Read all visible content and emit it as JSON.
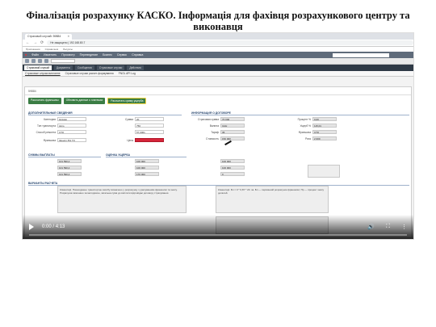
{
  "slide": {
    "title": "Фіналізація розрахунку КАСКО. Інформація для фахівця розрахункового центру та виконавця"
  },
  "browser": {
    "tab_label": "Страховой случай: 59884",
    "url": "Не защищено | 192.168.80.7",
    "bookmarks": [
      "Приложения",
      "Справочник",
      "Ресурсы"
    ]
  },
  "app": {
    "menu": [
      "Файл",
      "Изменить",
      "Просмотр",
      "Переведение",
      "Бизнес",
      "Сервис",
      "Справка"
    ],
    "window_tabs": [
      "Страховой случай",
      "Документы",
      "Сообщения",
      "Страховые случаи",
      "Действия"
    ],
    "sub_tabs": [
      "Страховые случаи виплатне",
      "Страховые случаи расчет-формування",
      "FNOL API Log"
    ],
    "panel_id": "59884",
    "actions": [
      "Рассчитать франшизы",
      "Обновить данные о платежах",
      "Рассчитать сумму ущерба"
    ],
    "sections": {
      "general": "Дополнительные сведения",
      "contract": "Информация о договоре",
      "payout": "Суммы выплаты",
      "damage": "Оценка ущерба",
      "calc": "Варианты расчета"
    },
    "fields": {
      "level": "Низкая",
      "level_label": "Категория",
      "vehicle_label": "Тип транспорта",
      "vehicle": "Авто",
      "sto_label": "Способ ремонта",
      "sto": "СТО",
      "amount_label": "Сумма",
      "amount": "1",
      "deductible_label": "Франшиза",
      "deductible_val": "Зачисл.5% ТЗ",
      "sum1": "20",
      "sum2": "750",
      "sum3": "57,0001",
      "price_label": "Цена",
      "ins_sum_label": "Страховая сумма",
      "ins_sum": "70 000",
      "currency_label": "Валюта",
      "currency": "UAH",
      "tariff_label": "Тариф",
      "tariff": "36",
      "ins_value_label": "Стоимость",
      "ins_value": "150 000",
      "pct_label": "Процент %",
      "pct": "0,00",
      "damage_label": "Ущерб %",
      "damage": "115,01",
      "ded_label": "Франшиза",
      "ded": "СТО",
      "ded_pct": "1",
      "ded_sum": "0",
      "risk_label": "Риск",
      "risk": "2 000",
      "payout1": "101 590,2",
      "payout2": "101 590,2",
      "payout3": "101 590,2",
      "est1": "100 000",
      "est2": "100 000",
      "est3": "170 000",
      "est_r1": "100 000",
      "est_r2": "100 000",
      "est_r3": "0",
      "notes_left": "Коментарі. Пошкоджене транспортне засобу визначено у розрахунку з урахуванням франшизи та зносу. Розрахунок виконано за методикою, загальна сума до виплати відповідає договору страхування.",
      "notes_right": "Коментарі. Бл = 0 * 0,87 * 20. за. Бл — первинний розрахунок франшизи; Пр — процент зносу деталей."
    }
  },
  "video": {
    "current_time": "0:00",
    "duration": "4:13",
    "progress": 0.0
  }
}
